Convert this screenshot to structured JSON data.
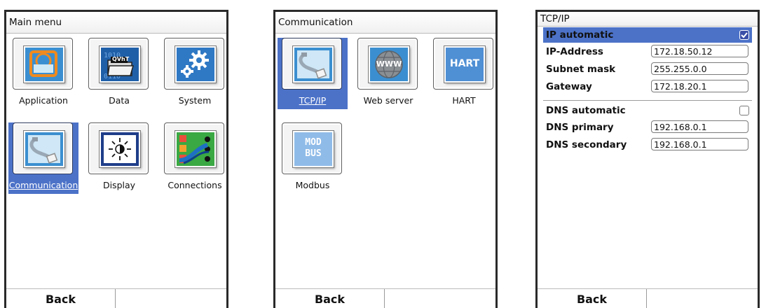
{
  "main_menu": {
    "title": "Main menu",
    "tiles": [
      {
        "label": "Application",
        "icon": "application-icon"
      },
      {
        "label": "Data",
        "icon": "data-folder-icon",
        "icon_text": "QVhT"
      },
      {
        "label": "System",
        "icon": "gear-icon"
      },
      {
        "label": "Communication",
        "icon": "communication-icon",
        "selected": true
      },
      {
        "label": "Display",
        "icon": "brightness-icon"
      },
      {
        "label": "Connections",
        "icon": "connections-icon"
      }
    ],
    "footer": {
      "back": "Back"
    }
  },
  "communication": {
    "title": "Communication",
    "tiles": [
      {
        "label": "TCP/IP",
        "icon": "communication-icon",
        "selected": true
      },
      {
        "label": "Web server",
        "icon": "globe-icon",
        "icon_text": "WWW"
      },
      {
        "label": "HART",
        "icon": "hart-icon",
        "icon_text": "HART"
      },
      {
        "label": "Modbus",
        "icon": "modbus-icon",
        "icon_text_1": "MOD",
        "icon_text_2": "BUS"
      }
    ],
    "footer": {
      "back": "Back"
    }
  },
  "tcpip": {
    "title": "TCP/IP",
    "ip_automatic": {
      "label": "IP automatic",
      "checked": true
    },
    "ip_address": {
      "label": "IP-Address",
      "value": "172.18.50.12"
    },
    "subnet_mask": {
      "label": "Subnet mask",
      "value": "255.255.0.0"
    },
    "gateway": {
      "label": "Gateway",
      "value": "172.18.20.1"
    },
    "dns_automatic": {
      "label": "DNS automatic",
      "checked": false
    },
    "dns_primary": {
      "label": "DNS primary",
      "value": "192.168.0.1"
    },
    "dns_secondary": {
      "label": "DNS secondary",
      "value": "192.168.0.1"
    },
    "footer": {
      "back": "Back"
    }
  },
  "colors": {
    "selection": "#4c72c8",
    "icon_blue": "#3b8fd0",
    "frame": "#2a2a2a"
  }
}
